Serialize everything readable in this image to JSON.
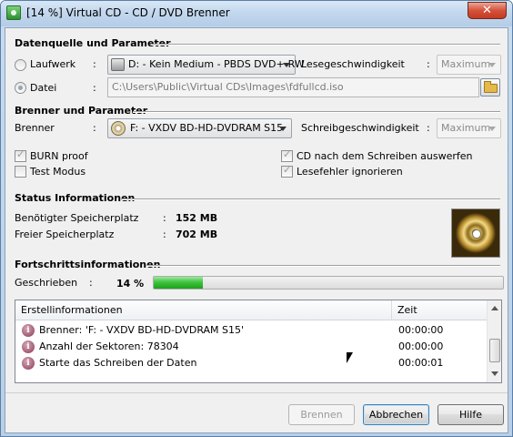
{
  "window": {
    "title": "[14 %] Virtual CD - CD / DVD Brenner",
    "close_glyph": "✕"
  },
  "source": {
    "section_title": "Datenquelle und Parameter",
    "drive_radio_label": "Laufwerk",
    "drive_colon": ":",
    "drive_value": "D: - Kein Medium - PBDS DVD+-RW",
    "read_speed_label": "Lesegeschwindigkeit",
    "read_speed_colon": ":",
    "read_speed_value": "Maximum",
    "file_radio_label": "Datei",
    "file_colon": ":",
    "file_path": "C:\\Users\\Public\\Virtual CDs\\Images\\fdfullcd.iso"
  },
  "burner": {
    "section_title": "Brenner und Parameter",
    "burner_label": "Brenner",
    "burner_colon": ":",
    "burner_value": "F: - VXDV BD-HD-DVDRAM S15",
    "write_speed_label": "Schreibgeschwindigkeit",
    "write_speed_colon": ":",
    "write_speed_value": "Maximum",
    "burn_proof_label": "BURN proof",
    "burn_proof_checked": true,
    "test_mode_label": "Test Modus",
    "test_mode_checked": false,
    "eject_label": "CD nach dem Schreiben auswerfen",
    "eject_checked": true,
    "ignore_errors_label": "Lesefehler ignorieren",
    "ignore_errors_checked": true
  },
  "status": {
    "section_title": "Status Informationen",
    "required_label": "Benötigter Speicherplatz",
    "required_colon": ":",
    "required_value": "152 MB",
    "free_label": "Freier Speicherplatz",
    "free_colon": ":",
    "free_value": "702 MB"
  },
  "progress": {
    "section_title": "Fortschrittsinformationen",
    "written_label": "Geschrieben",
    "written_colon": ":",
    "written_percent_text": "14 %",
    "fraction": 0.14
  },
  "log": {
    "col_info": "Erstellinformationen",
    "col_time": "Zeit",
    "rows": [
      {
        "text": "Brenner: 'F: - VXDV BD-HD-DVDRAM S15'",
        "time": "00:00:00"
      },
      {
        "text": "Anzahl der Sektoren: 78304",
        "time": "00:00:00"
      },
      {
        "text": "Starte das Schreiben der Daten",
        "time": "00:00:01"
      }
    ],
    "info_glyph": "i"
  },
  "buttons": {
    "burn": "Brennen",
    "cancel": "Abbrechen",
    "help": "Hilfe"
  },
  "colors": {
    "progress_green": "#3fc43f",
    "title_bar": "#c3d8ee"
  }
}
